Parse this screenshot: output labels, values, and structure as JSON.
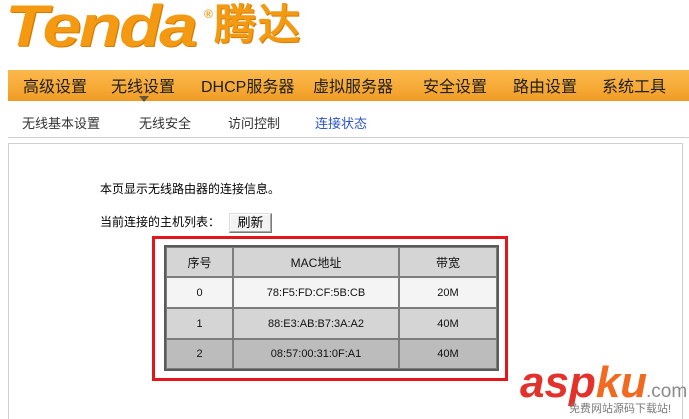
{
  "brand": {
    "logo_text": "Tenda",
    "registered": "®",
    "logo_cn": "腾达"
  },
  "nav": {
    "items": [
      {
        "label": "高级设置",
        "active": false
      },
      {
        "label": "无线设置",
        "active": true
      },
      {
        "label": "DHCP服务器",
        "active": false
      },
      {
        "label": "虚拟服务器",
        "active": false
      },
      {
        "label": "安全设置",
        "active": false
      },
      {
        "label": "路由设置",
        "active": false
      },
      {
        "label": "系统工具",
        "active": false
      }
    ]
  },
  "subnav": {
    "items": [
      {
        "label": "无线基本设置",
        "active": false
      },
      {
        "label": "无线安全",
        "active": false
      },
      {
        "label": "访问控制",
        "active": false
      },
      {
        "label": "连接状态",
        "active": true
      }
    ]
  },
  "content": {
    "description": "本页显示无线路由器的连接信息。",
    "host_list_label": "当前连接的主机列表：",
    "refresh_button": "刷新"
  },
  "host_table": {
    "headers": [
      "序号",
      "MAC地址",
      "带宽"
    ],
    "rows": [
      [
        "0",
        "78:F5:FD:CF:5B:CB",
        "20M"
      ],
      [
        "1",
        "88:E3:AB:B7:3A:A2",
        "40M"
      ],
      [
        "2",
        "08:57:00:31:0F:A1",
        "40M"
      ]
    ]
  },
  "watermark": {
    "asp": "asp",
    "ku": "ku",
    "domain_suffix": ".com",
    "tagline": "免费网站源码下载站!"
  },
  "icons": {
    "active_tab_pointer": "triangle-down-icon"
  },
  "colors": {
    "brand_orange": "#f39a12",
    "nav_bar": "#f6a935",
    "active_subnav": "#2b55c8",
    "highlight_box": "#e3161b",
    "table_header": "#d5d5d5",
    "row_0": "#f4f4f4",
    "row_1": "#d5d5d5",
    "row_2": "#bcbcbc",
    "watermark_red": "#e3312b",
    "watermark_orange": "#f06a22"
  }
}
